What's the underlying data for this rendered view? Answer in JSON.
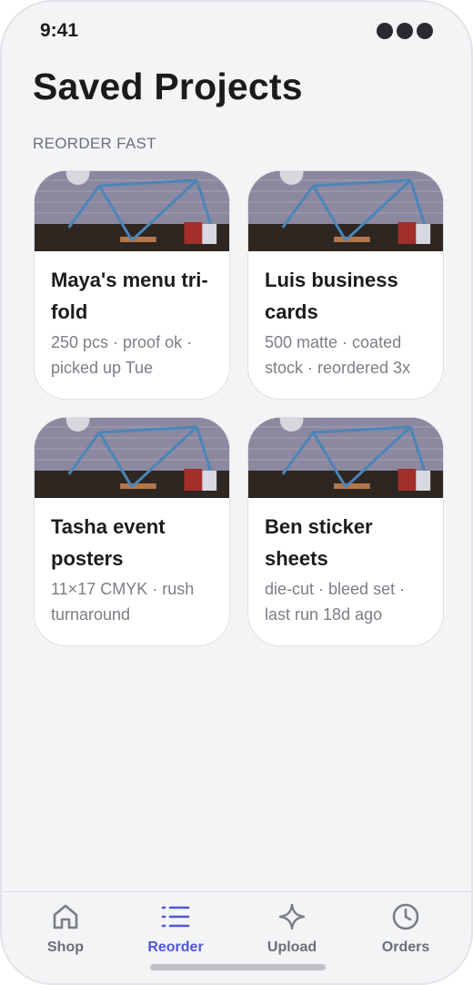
{
  "status_bar": {
    "time": "9:41"
  },
  "header": {
    "title": "Saved Projects"
  },
  "section": {
    "label": "REORDER FAST"
  },
  "projects": [
    {
      "title": "Maya's menu tri-fold",
      "meta": "250 pcs · proof ok · picked up Tue"
    },
    {
      "title": "Luis business cards",
      "meta": "500 matte · coated stock · reordered 3x"
    },
    {
      "title": "Tasha event posters",
      "meta": "11×17 CMYK · rush turnaround"
    },
    {
      "title": "Ben sticker sheets",
      "meta": "die-cut · bleed set · last run 18d ago"
    }
  ],
  "tabs": [
    {
      "label": "Shop",
      "icon": "home-icon",
      "active": false
    },
    {
      "label": "Reorder",
      "icon": "list-icon",
      "active": true
    },
    {
      "label": "Upload",
      "icon": "sparkle-icon",
      "active": false
    },
    {
      "label": "Orders",
      "icon": "clock-icon",
      "active": false
    }
  ],
  "colors": {
    "accent": "#4f57d6",
    "background": "#f3f4f6",
    "card": "#ffffff"
  }
}
